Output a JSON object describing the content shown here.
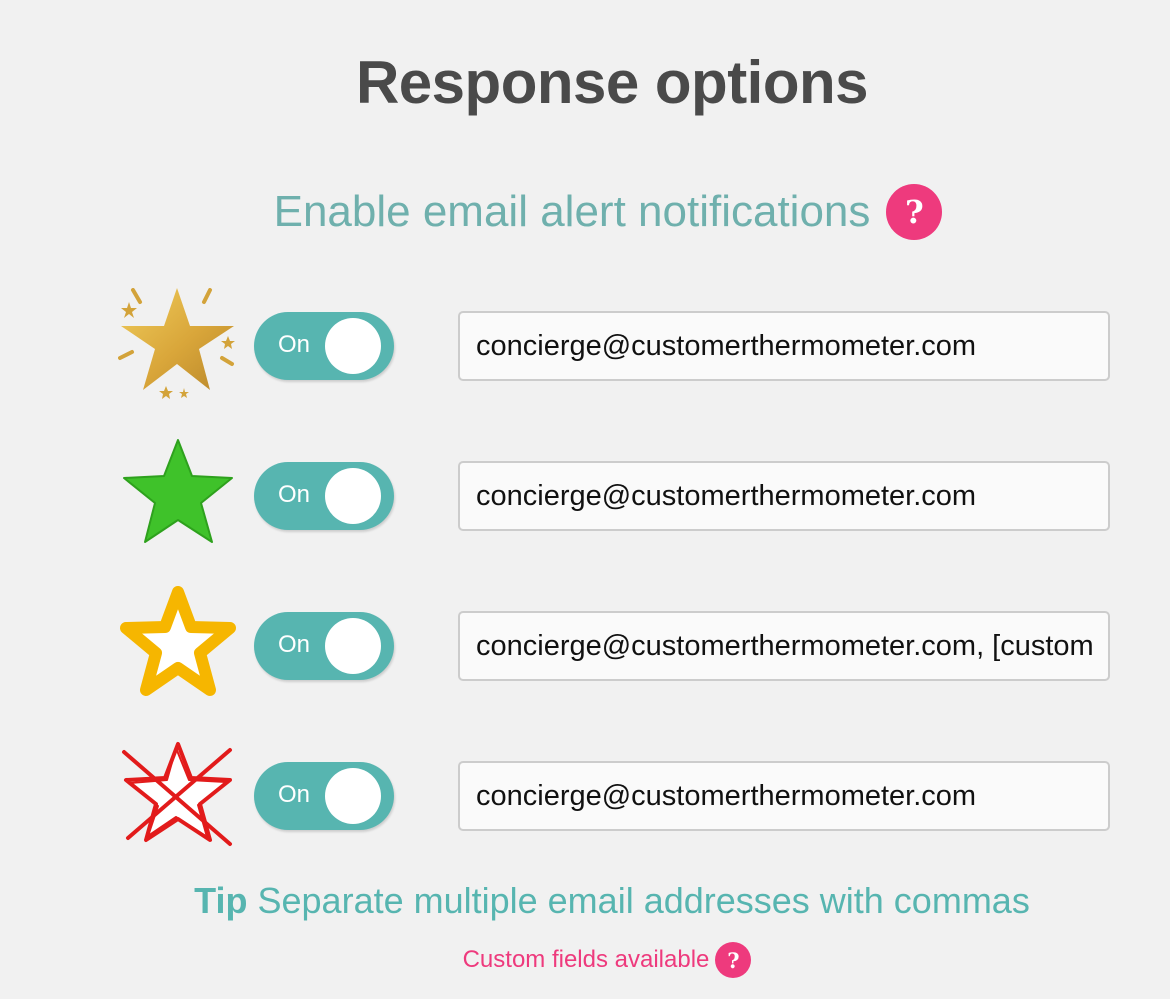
{
  "page": {
    "title": "Response options",
    "subtitle": "Enable email alert notifications",
    "help_symbol": "?"
  },
  "colors": {
    "background": "#f1f1f1",
    "teal": "#57b5b0",
    "pink": "#ee3a7d",
    "title": "#4a4a4a"
  },
  "rows": [
    {
      "icon": "gold-sparkle-star-icon",
      "toggle": {
        "label": "On",
        "state": "on"
      },
      "email": "concierge@customerthermometer.com"
    },
    {
      "icon": "green-star-icon",
      "toggle": {
        "label": "On",
        "state": "on"
      },
      "email": "concierge@customerthermometer.com"
    },
    {
      "icon": "yellow-outline-star-icon",
      "toggle": {
        "label": "On",
        "state": "on"
      },
      "email": "concierge@customerthermometer.com, [customer_email]"
    },
    {
      "icon": "red-crossed-star-icon",
      "toggle": {
        "label": "On",
        "state": "on"
      },
      "email": "concierge@customerthermometer.com"
    }
  ],
  "tip": {
    "label": "Tip",
    "text": "Separate multiple email addresses with commas"
  },
  "custom_fields": {
    "text": "Custom fields available",
    "help_symbol": "?"
  }
}
